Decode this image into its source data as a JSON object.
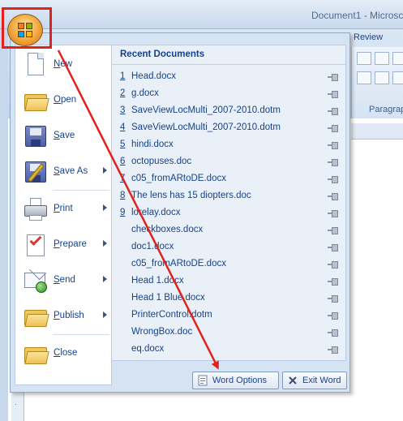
{
  "window": {
    "title": "Document1 - Microsc"
  },
  "ribbon": {
    "visible_tab": "Review",
    "group_label": "Paragrap"
  },
  "left_ruler": {
    "marks": [
      "2",
      "·"
    ]
  },
  "office_menu": {
    "commands": [
      {
        "label": "New",
        "icon": "new-document-icon",
        "has_submenu": false
      },
      {
        "label": "Open",
        "icon": "open-folder-icon",
        "has_submenu": false
      },
      {
        "label": "Save",
        "icon": "save-disk-icon",
        "has_submenu": false
      },
      {
        "label": "Save As",
        "icon": "save-as-icon",
        "has_submenu": true
      },
      {
        "label": "Print",
        "icon": "printer-icon",
        "has_submenu": true
      },
      {
        "label": "Prepare",
        "icon": "prepare-icon",
        "has_submenu": true
      },
      {
        "label": "Send",
        "icon": "send-icon",
        "has_submenu": true
      },
      {
        "label": "Publish",
        "icon": "publish-icon",
        "has_submenu": true
      },
      {
        "label": "Close",
        "icon": "close-folder-icon",
        "has_submenu": false
      }
    ],
    "recent_documents": {
      "header": "Recent Documents",
      "items": [
        {
          "num": "1",
          "name": "Head.docx"
        },
        {
          "num": "2",
          "name": "g.docx"
        },
        {
          "num": "3",
          "name": "SaveViewLocMulti_2007-2010.dotm"
        },
        {
          "num": "4",
          "name": "SaveViewLocMulti_2007-2010.dotm"
        },
        {
          "num": "5",
          "name": "hindi.docx"
        },
        {
          "num": "6",
          "name": "octopuses.doc"
        },
        {
          "num": "7",
          "name": "c05_fromARtoDE.docx"
        },
        {
          "num": "8",
          "name": "The lens has 15 diopters.doc"
        },
        {
          "num": "9",
          "name": "lorelay.docx"
        },
        {
          "num": "",
          "name": "checkboxes.docx"
        },
        {
          "num": "",
          "name": "doc1.docx"
        },
        {
          "num": "",
          "name": "c05_fromARtoDE.docx"
        },
        {
          "num": "",
          "name": "Head 1.docx"
        },
        {
          "num": "",
          "name": "Head 1 Blue.docx"
        },
        {
          "num": "",
          "name": "PrinterControl.dotm"
        },
        {
          "num": "",
          "name": "WrongBox.doc"
        },
        {
          "num": "",
          "name": "eq.docx"
        }
      ]
    },
    "word_options_label": "Word Options",
    "exit_word_label": "Exit Word"
  },
  "annotation": {
    "highlight_color": "#e2201c",
    "arrow_color": "#e2201c"
  }
}
